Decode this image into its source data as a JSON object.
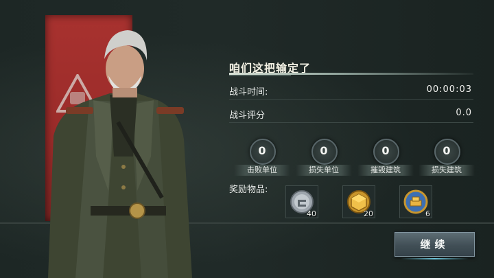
{
  "result": {
    "title": "咱们这把输定了",
    "battle_time_label": "战斗时间:",
    "battle_time_value": "00:00:03",
    "battle_score_label": "战斗评分",
    "battle_score_value": "0.0"
  },
  "counters": [
    {
      "value": "0",
      "label": "击败单位"
    },
    {
      "value": "0",
      "label": "损失单位"
    },
    {
      "value": "0",
      "label": "摧毁建筑"
    },
    {
      "value": "0",
      "label": "损失建筑"
    }
  ],
  "rewards": {
    "label": "奖励物品:",
    "items": [
      {
        "icon": "silver-coin-icon",
        "count": "40"
      },
      {
        "icon": "gold-crate-icon",
        "count": "20"
      },
      {
        "icon": "gold-bar-badge-icon",
        "count": "6"
      }
    ]
  },
  "buttons": {
    "continue_label": "继续"
  },
  "colors": {
    "banner_red": "#a8322f",
    "panel_bg": "#1b2422",
    "button_accent": "#6ec6dc"
  }
}
